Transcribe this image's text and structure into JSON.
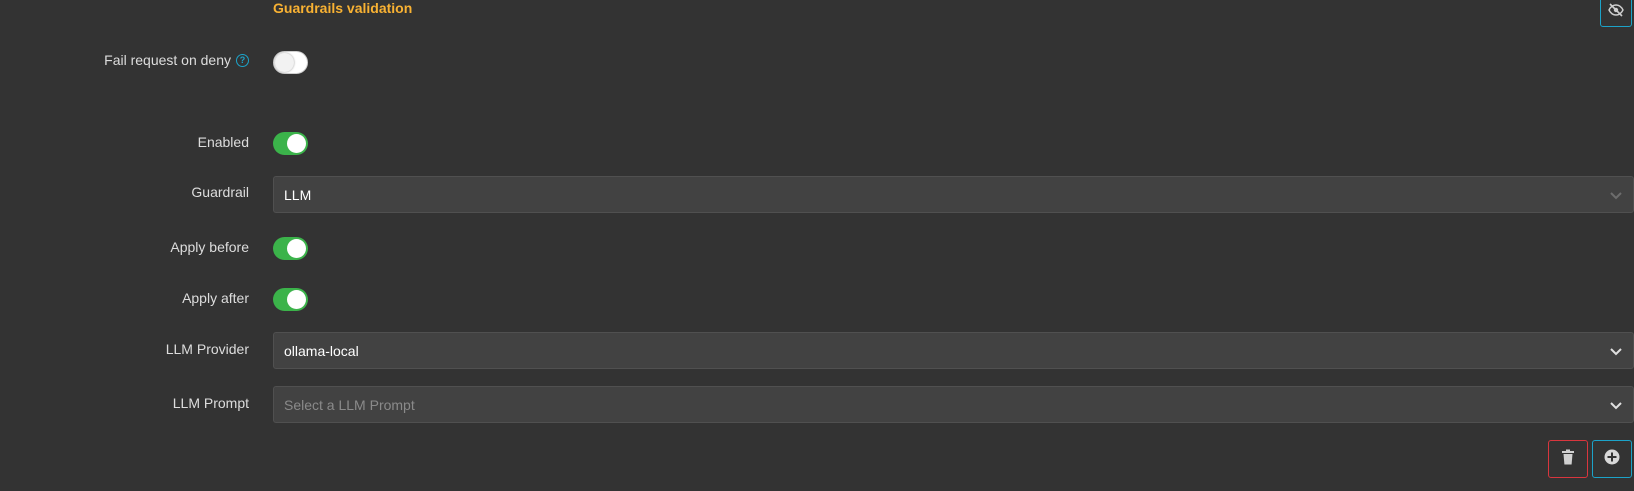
{
  "section": {
    "title": "Guardrails validation"
  },
  "fields": {
    "fail_request_on_deny": {
      "label": "Fail request on deny",
      "help": "?",
      "enabled": false
    },
    "enabled": {
      "label": "Enabled",
      "enabled": true
    },
    "guardrail": {
      "label": "Guardrail",
      "value": "LLM"
    },
    "apply_before": {
      "label": "Apply before",
      "enabled": true
    },
    "apply_after": {
      "label": "Apply after",
      "enabled": true
    },
    "llm_provider": {
      "label": "LLM Provider",
      "value": "ollama-local"
    },
    "llm_prompt": {
      "label": "LLM Prompt",
      "placeholder": "Select a LLM Prompt"
    }
  },
  "icons": {
    "visibility": "eye-slash-icon",
    "delete": "trash-icon",
    "add": "plus-circle-icon",
    "dropdown": "chevron-down-icon"
  },
  "colors": {
    "accent": "#f9b233",
    "toggle_on": "#3bb34a",
    "info": "#1ca3c9",
    "danger": "#d9363e",
    "background": "#333333"
  }
}
